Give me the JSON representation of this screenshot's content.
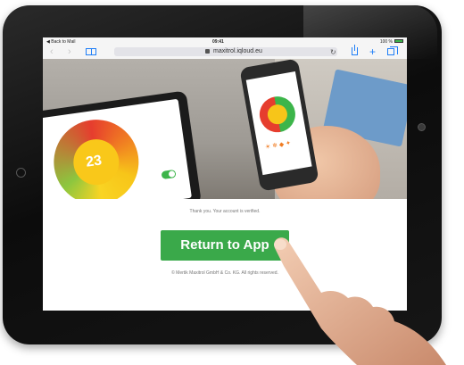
{
  "status_bar": {
    "back_label": "◀ Back to Mail",
    "time": "09:41",
    "battery": "100 %"
  },
  "browser": {
    "url": "maxitrol.iqloud.eu"
  },
  "hero": {
    "tablet_gauge_value": "23"
  },
  "page": {
    "message": "Thank you. Your account is verified.",
    "button_label": "Return to App",
    "copyright": "© Mertik Maxitrol GmbH & Co. KG. All rights reserved."
  },
  "icons": {
    "back": "chevron-left-icon",
    "forward": "chevron-right-icon",
    "bookmarks": "book-icon",
    "lock": "lock-icon",
    "reload": "reload-icon",
    "share": "share-icon",
    "add": "plus-icon",
    "tabs": "tabs-icon"
  },
  "colors": {
    "button": "#3aa94a",
    "ios_blue": "#1e7ef7",
    "battery": "#3cb54a"
  }
}
